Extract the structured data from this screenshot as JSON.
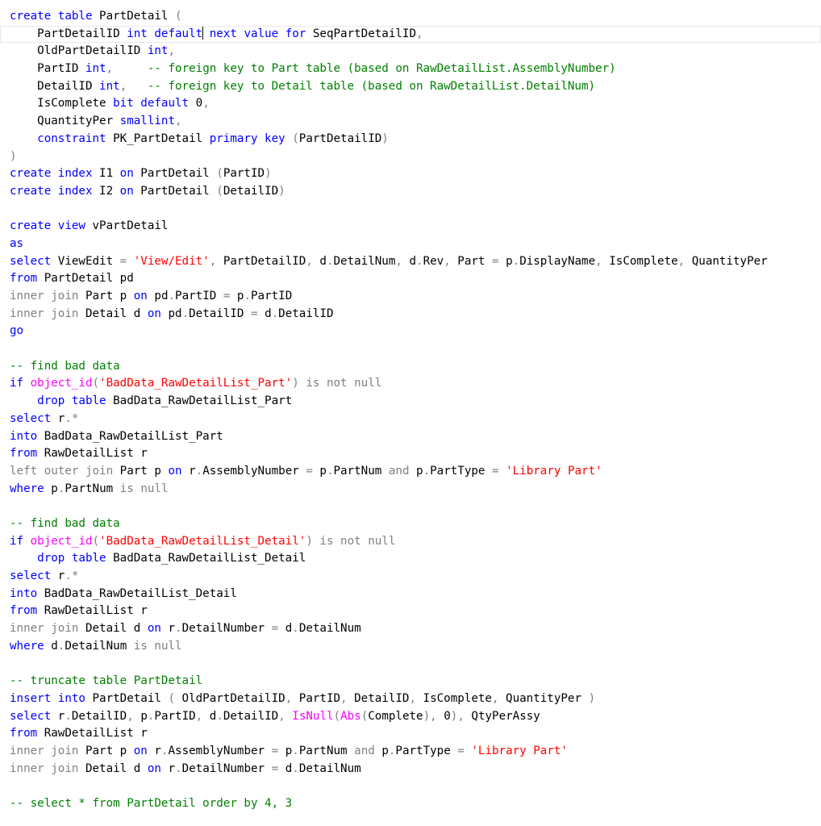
{
  "editor": {
    "name": "sql-editor",
    "caret_line": 1,
    "caret_segment": 4
  },
  "colors": {
    "keyword": "#0000ff",
    "operator": "#808080",
    "string": "#ff0000",
    "comment": "#008000",
    "function": "#ff00ff",
    "text": "#000000"
  },
  "lines": [
    [
      [
        "k",
        "create table"
      ],
      [
        "n",
        " PartDetail "
      ],
      [
        "g",
        "("
      ]
    ],
    [
      [
        "n",
        "    PartDetailID "
      ],
      [
        "k",
        "int"
      ],
      [
        "n",
        " "
      ],
      [
        "k",
        "default"
      ],
      [
        "n",
        " "
      ],
      [
        "k",
        "next value for"
      ],
      [
        "n",
        " SeqPartDetailID"
      ],
      [
        "g",
        ","
      ]
    ],
    [
      [
        "n",
        "    OldPartDetailID "
      ],
      [
        "k",
        "int"
      ],
      [
        "g",
        ","
      ]
    ],
    [
      [
        "n",
        "    PartID "
      ],
      [
        "k",
        "int"
      ],
      [
        "g",
        ","
      ],
      [
        "n",
        "     "
      ],
      [
        "c",
        "-- foreign key to Part table (based on RawDetailList.AssemblyNumber)"
      ]
    ],
    [
      [
        "n",
        "    DetailID "
      ],
      [
        "k",
        "int"
      ],
      [
        "g",
        ","
      ],
      [
        "n",
        "   "
      ],
      [
        "c",
        "-- foreign key to Detail table (based on RawDetailList.DetailNum)"
      ]
    ],
    [
      [
        "n",
        "    IsComplete "
      ],
      [
        "k",
        "bit default"
      ],
      [
        "n",
        " 0"
      ],
      [
        "g",
        ","
      ]
    ],
    [
      [
        "n",
        "    QuantityPer "
      ],
      [
        "k",
        "smallint"
      ],
      [
        "g",
        ","
      ]
    ],
    [
      [
        "n",
        "    "
      ],
      [
        "k",
        "constraint"
      ],
      [
        "n",
        " PK_PartDetail "
      ],
      [
        "k",
        "primary key"
      ],
      [
        "n",
        " "
      ],
      [
        "g",
        "("
      ],
      [
        "n",
        "PartDetailID"
      ],
      [
        "g",
        ")"
      ]
    ],
    [
      [
        "g",
        ")"
      ]
    ],
    [
      [
        "k",
        "create index"
      ],
      [
        "n",
        " I1 "
      ],
      [
        "k",
        "on"
      ],
      [
        "n",
        " PartDetail "
      ],
      [
        "g",
        "("
      ],
      [
        "n",
        "PartID"
      ],
      [
        "g",
        ")"
      ]
    ],
    [
      [
        "k",
        "create index"
      ],
      [
        "n",
        " I2 "
      ],
      [
        "k",
        "on"
      ],
      [
        "n",
        " PartDetail "
      ],
      [
        "g",
        "("
      ],
      [
        "n",
        "DetailID"
      ],
      [
        "g",
        ")"
      ]
    ],
    [],
    [
      [
        "k",
        "create view"
      ],
      [
        "n",
        " vPartDetail"
      ]
    ],
    [
      [
        "k",
        "as"
      ]
    ],
    [
      [
        "k",
        "select"
      ],
      [
        "n",
        " ViewEdit "
      ],
      [
        "g",
        "="
      ],
      [
        "n",
        " "
      ],
      [
        "s",
        "'View/Edit'"
      ],
      [
        "g",
        ","
      ],
      [
        "n",
        " PartDetailID"
      ],
      [
        "g",
        ","
      ],
      [
        "n",
        " d"
      ],
      [
        "g",
        "."
      ],
      [
        "n",
        "DetailNum"
      ],
      [
        "g",
        ","
      ],
      [
        "n",
        " d"
      ],
      [
        "g",
        "."
      ],
      [
        "n",
        "Rev"
      ],
      [
        "g",
        ","
      ],
      [
        "n",
        " Part "
      ],
      [
        "g",
        "="
      ],
      [
        "n",
        " p"
      ],
      [
        "g",
        "."
      ],
      [
        "n",
        "DisplayName"
      ],
      [
        "g",
        ","
      ],
      [
        "n",
        " IsComplete"
      ],
      [
        "g",
        ","
      ],
      [
        "n",
        " QuantityPer"
      ]
    ],
    [
      [
        "k",
        "from"
      ],
      [
        "n",
        " PartDetail pd"
      ]
    ],
    [
      [
        "g",
        "inner join"
      ],
      [
        "n",
        " Part p "
      ],
      [
        "k",
        "on"
      ],
      [
        "n",
        " pd"
      ],
      [
        "g",
        "."
      ],
      [
        "n",
        "PartID "
      ],
      [
        "g",
        "="
      ],
      [
        "n",
        " p"
      ],
      [
        "g",
        "."
      ],
      [
        "n",
        "PartID"
      ]
    ],
    [
      [
        "g",
        "inner join"
      ],
      [
        "n",
        " Detail d "
      ],
      [
        "k",
        "on"
      ],
      [
        "n",
        " pd"
      ],
      [
        "g",
        "."
      ],
      [
        "n",
        "DetailID "
      ],
      [
        "g",
        "="
      ],
      [
        "n",
        " d"
      ],
      [
        "g",
        "."
      ],
      [
        "n",
        "DetailID"
      ]
    ],
    [
      [
        "k",
        "go"
      ]
    ],
    [],
    [
      [
        "c",
        "-- find bad data"
      ]
    ],
    [
      [
        "k",
        "if"
      ],
      [
        "n",
        " "
      ],
      [
        "f",
        "object_id"
      ],
      [
        "g",
        "("
      ],
      [
        "s",
        "'BadData_RawDetailList_Part'"
      ],
      [
        "g",
        ")"
      ],
      [
        "n",
        " "
      ],
      [
        "g",
        "is not null"
      ]
    ],
    [
      [
        "n",
        "    "
      ],
      [
        "k",
        "drop table"
      ],
      [
        "n",
        " BadData_RawDetailList_Part"
      ]
    ],
    [
      [
        "k",
        "select"
      ],
      [
        "n",
        " r"
      ],
      [
        "g",
        ".*"
      ]
    ],
    [
      [
        "k",
        "into"
      ],
      [
        "n",
        " BadData_RawDetailList_Part"
      ]
    ],
    [
      [
        "k",
        "from"
      ],
      [
        "n",
        " RawDetailList r"
      ]
    ],
    [
      [
        "g",
        "left outer join"
      ],
      [
        "n",
        " Part p "
      ],
      [
        "k",
        "on"
      ],
      [
        "n",
        " r"
      ],
      [
        "g",
        "."
      ],
      [
        "n",
        "AssemblyNumber "
      ],
      [
        "g",
        "="
      ],
      [
        "n",
        " p"
      ],
      [
        "g",
        "."
      ],
      [
        "n",
        "PartNum "
      ],
      [
        "g",
        "and"
      ],
      [
        "n",
        " p"
      ],
      [
        "g",
        "."
      ],
      [
        "n",
        "PartType "
      ],
      [
        "g",
        "="
      ],
      [
        "n",
        " "
      ],
      [
        "s",
        "'Library Part'"
      ]
    ],
    [
      [
        "k",
        "where"
      ],
      [
        "n",
        " p"
      ],
      [
        "g",
        "."
      ],
      [
        "n",
        "PartNum "
      ],
      [
        "g",
        "is null"
      ]
    ],
    [],
    [
      [
        "c",
        "-- find bad data"
      ]
    ],
    [
      [
        "k",
        "if"
      ],
      [
        "n",
        " "
      ],
      [
        "f",
        "object_id"
      ],
      [
        "g",
        "("
      ],
      [
        "s",
        "'BadData_RawDetailList_Detail'"
      ],
      [
        "g",
        ")"
      ],
      [
        "n",
        " "
      ],
      [
        "g",
        "is not null"
      ]
    ],
    [
      [
        "n",
        "    "
      ],
      [
        "k",
        "drop table"
      ],
      [
        "n",
        " BadData_RawDetailList_Detail"
      ]
    ],
    [
      [
        "k",
        "select"
      ],
      [
        "n",
        " r"
      ],
      [
        "g",
        ".*"
      ]
    ],
    [
      [
        "k",
        "into"
      ],
      [
        "n",
        " BadData_RawDetailList_Detail"
      ]
    ],
    [
      [
        "k",
        "from"
      ],
      [
        "n",
        " RawDetailList r"
      ]
    ],
    [
      [
        "g",
        "inner join"
      ],
      [
        "n",
        " Detail d "
      ],
      [
        "k",
        "on"
      ],
      [
        "n",
        " r"
      ],
      [
        "g",
        "."
      ],
      [
        "n",
        "DetailNumber "
      ],
      [
        "g",
        "="
      ],
      [
        "n",
        " d"
      ],
      [
        "g",
        "."
      ],
      [
        "n",
        "DetailNum"
      ]
    ],
    [
      [
        "k",
        "where"
      ],
      [
        "n",
        " d"
      ],
      [
        "g",
        "."
      ],
      [
        "n",
        "DetailNum "
      ],
      [
        "g",
        "is null"
      ]
    ],
    [],
    [
      [
        "c",
        "-- truncate table PartDetail"
      ]
    ],
    [
      [
        "k",
        "insert into"
      ],
      [
        "n",
        " PartDetail "
      ],
      [
        "g",
        "("
      ],
      [
        "n",
        " OldPartDetailID"
      ],
      [
        "g",
        ","
      ],
      [
        "n",
        " PartID"
      ],
      [
        "g",
        ","
      ],
      [
        "n",
        " DetailID"
      ],
      [
        "g",
        ","
      ],
      [
        "n",
        " IsComplete"
      ],
      [
        "g",
        ","
      ],
      [
        "n",
        " QuantityPer "
      ],
      [
        "g",
        ")"
      ]
    ],
    [
      [
        "k",
        "select"
      ],
      [
        "n",
        " r"
      ],
      [
        "g",
        "."
      ],
      [
        "n",
        "DetailID"
      ],
      [
        "g",
        ","
      ],
      [
        "n",
        " p"
      ],
      [
        "g",
        "."
      ],
      [
        "n",
        "PartID"
      ],
      [
        "g",
        ","
      ],
      [
        "n",
        " d"
      ],
      [
        "g",
        "."
      ],
      [
        "n",
        "DetailID"
      ],
      [
        "g",
        ","
      ],
      [
        "n",
        " "
      ],
      [
        "f",
        "IsNull"
      ],
      [
        "g",
        "("
      ],
      [
        "f",
        "Abs"
      ],
      [
        "g",
        "("
      ],
      [
        "n",
        "Complete"
      ],
      [
        "g",
        "),"
      ],
      [
        "n",
        " 0"
      ],
      [
        "g",
        "),"
      ],
      [
        "n",
        " QtyPerAssy"
      ]
    ],
    [
      [
        "k",
        "from"
      ],
      [
        "n",
        " RawDetailList r"
      ]
    ],
    [
      [
        "g",
        "inner join"
      ],
      [
        "n",
        " Part p "
      ],
      [
        "k",
        "on"
      ],
      [
        "n",
        " r"
      ],
      [
        "g",
        "."
      ],
      [
        "n",
        "AssemblyNumber "
      ],
      [
        "g",
        "="
      ],
      [
        "n",
        " p"
      ],
      [
        "g",
        "."
      ],
      [
        "n",
        "PartNum "
      ],
      [
        "g",
        "and"
      ],
      [
        "n",
        " p"
      ],
      [
        "g",
        "."
      ],
      [
        "n",
        "PartType "
      ],
      [
        "g",
        "="
      ],
      [
        "n",
        " "
      ],
      [
        "s",
        "'Library Part'"
      ]
    ],
    [
      [
        "g",
        "inner join"
      ],
      [
        "n",
        " Detail d "
      ],
      [
        "k",
        "on"
      ],
      [
        "n",
        " r"
      ],
      [
        "g",
        "."
      ],
      [
        "n",
        "DetailNumber "
      ],
      [
        "g",
        "="
      ],
      [
        "n",
        " d"
      ],
      [
        "g",
        "."
      ],
      [
        "n",
        "DetailNum"
      ]
    ],
    [],
    [
      [
        "c",
        "-- select * from PartDetail order by 4, 3"
      ]
    ]
  ]
}
